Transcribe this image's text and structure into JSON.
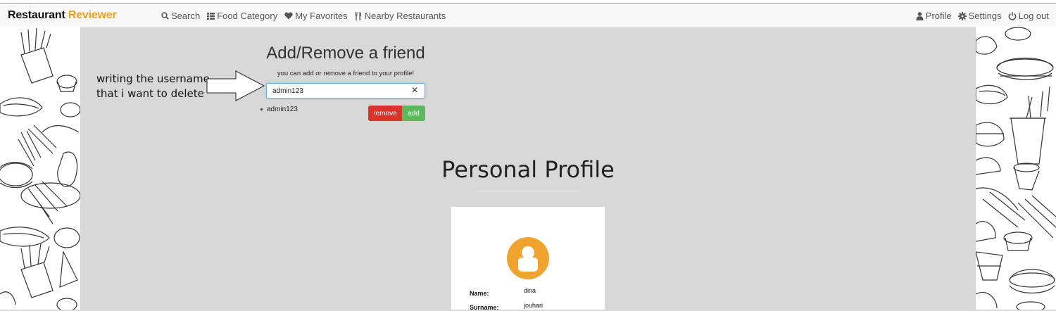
{
  "brand": {
    "part1": "Restaurant",
    "part2": "Reviewer"
  },
  "nav": {
    "search": "Search",
    "food_category": "Food Category",
    "favorites": "My Favorites",
    "nearby": "Nearby Restaurants",
    "profile": "Profile",
    "settings": "Settings",
    "logout": "Log out"
  },
  "annotation": {
    "line1": "writing the username",
    "line2": "that i want to delete"
  },
  "friend": {
    "title": "Add/Remove a friend",
    "subtitle": "you can add or remove a friend to your profile!",
    "input_value": "admin123",
    "list": [
      "admin123"
    ],
    "remove_label": "remove",
    "add_label": "add",
    "clear_symbol": "✕"
  },
  "profile": {
    "title": "Personal Profile",
    "fields": [
      {
        "label": "Name:",
        "value": "dina"
      },
      {
        "label": "Surname:",
        "value": "jouhari"
      }
    ]
  },
  "colors": {
    "brand_accent": "#f0a020",
    "avatar": "#f0a32e",
    "remove": "#d9332b",
    "add": "#5cb85c"
  }
}
